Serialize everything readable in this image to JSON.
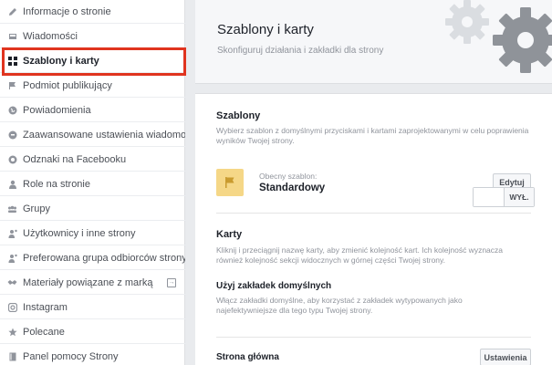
{
  "sidebar": {
    "items": [
      {
        "label": "Informacje o stronie",
        "icon": "pencil-icon"
      },
      {
        "label": "Wiadomości",
        "icon": "inbox-icon"
      },
      {
        "label": "Szablony i karty",
        "icon": "grid-icon",
        "active": true
      },
      {
        "label": "Podmiot publikujący",
        "icon": "flag-icon"
      },
      {
        "label": "Powiadomienia",
        "icon": "globe-icon"
      },
      {
        "label": "Zaawansowane ustawienia wiadomości",
        "icon": "chat-icon"
      },
      {
        "label": "Odznaki na Facebooku",
        "icon": "badge-icon"
      },
      {
        "label": "Role na stronie",
        "icon": "person-icon"
      },
      {
        "label": "Grupy",
        "icon": "group-icon"
      },
      {
        "label": "Użytkownicy i inne strony",
        "icon": "person-star-icon"
      },
      {
        "label": "Preferowana grupa odbiorców strony",
        "icon": "person-star-icon"
      },
      {
        "label": "Materiały powiązane z marką",
        "icon": "handshake-icon"
      },
      {
        "label": "Instagram",
        "icon": "instagram-icon"
      },
      {
        "label": "Polecane",
        "icon": "star-icon"
      },
      {
        "label": "Panel pomocy Strony",
        "icon": "book-icon"
      }
    ]
  },
  "header": {
    "title": "Szablony i karty",
    "subtitle": "Skonfiguruj działania i zakładki dla strony"
  },
  "templates": {
    "title": "Szablony",
    "description": "Wybierz szablon z domyślnymi przyciskami i kartami zaprojektowanymi w celu poprawienia wyników Twojej strony.",
    "current_label": "Obecny szablon:",
    "current_value": "Standardowy",
    "edit_button": "Edytuj"
  },
  "tabs": {
    "title": "Karty",
    "description": "Kliknij i przeciągnij nazwę karty, aby zmienić kolejność kart. Ich kolejność wyznacza również kolejność sekcji widocznych w górnej części Twojej strony.",
    "default_tabs_title": "Użyj zakładek domyślnych",
    "default_tabs_desc": "Włącz zakładki domyślne, aby korzystać z zakładek wytypowanych jako najefektywniejsze dla tego typu Twojej strony.",
    "toggle_label": "WYŁ.",
    "home_title": "Strona główna",
    "settings_button": "Ustawienia"
  },
  "colors": {
    "highlight": "#e0341f",
    "template_icon_bg": "#f5d787",
    "gear": "#8f9399"
  }
}
